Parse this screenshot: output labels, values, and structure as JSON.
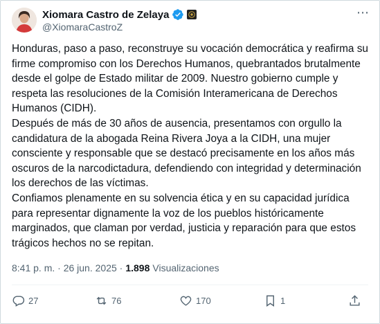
{
  "author": {
    "name": "Xiomara Castro de Zelaya",
    "handle": "@XiomaraCastroZ"
  },
  "tweet": {
    "text": "Honduras, paso a paso, reconstruye su vocación democrática y reafirma su\nfirme compromiso con los Derechos Humanos, quebrantados brutalmente\ndesde el golpe de Estado militar de 2009. Nuestro gobierno cumple y\nrespeta las resoluciones de la Comisión Interamericana de Derechos\nHumanos (CIDH).\nDespués de más de 30 años de ausencia, presentamos con orgullo la\ncandidatura de la abogada Reina Rivera Joya a la CIDH, una mujer\nconsciente y responsable que se destacó precisamente en los años más\noscuros de la narcodictadura, defendiendo con integridad y determinación\nlos derechos de las víctimas.\nConfiamos plenamente en su solvencia ética y en su capacidad jurídica\npara representar dignamente la voz de los pueblos históricamente\nmarginados, que claman por verdad, justicia y reparación para que estos\ntrágicos hechos no se repitan."
  },
  "meta": {
    "timestamp": "8:41 p. m. · 26 jun. 2025 ·",
    "views_count": "1.898",
    "views_label": "Visualizaciones"
  },
  "actions": {
    "replies": "27",
    "reposts": "76",
    "likes": "170",
    "bookmarks": "1"
  },
  "colors": {
    "verified": "#1d9bf0",
    "secondary_text": "#536471"
  }
}
